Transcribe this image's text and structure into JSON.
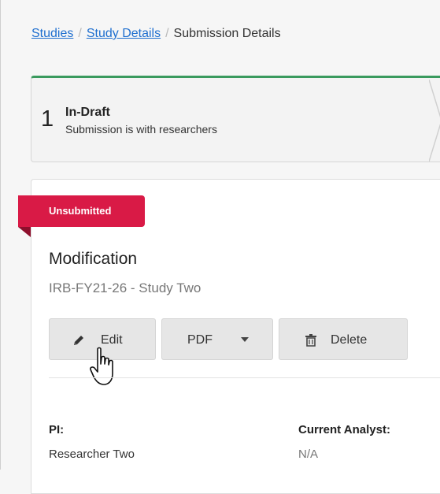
{
  "breadcrumb": {
    "studies": "Studies",
    "study_details": "Study Details",
    "current": "Submission Details",
    "separator": "/"
  },
  "step": {
    "number": "1",
    "title": "In-Draft",
    "subtitle": "Submission is with researchers"
  },
  "card": {
    "status_badge": "Unsubmitted",
    "title": "Modification",
    "subtitle": "IRB-FY21-26 - Study Two",
    "buttons": {
      "edit": "Edit",
      "pdf": "PDF",
      "delete": "Delete"
    },
    "fields": {
      "pi_label": "PI:",
      "pi_value": "Researcher Two",
      "analyst_label": "Current Analyst:",
      "analyst_value": "N/A"
    }
  },
  "icons": {
    "edit": "pencil-icon",
    "pdf_dropdown": "caret-down-icon",
    "delete": "trash-icon",
    "cursor": "hand-pointer-icon"
  },
  "colors": {
    "link": "#1f6fcf",
    "badge": "#d91a46",
    "step_accent": "#3a9a5e"
  }
}
